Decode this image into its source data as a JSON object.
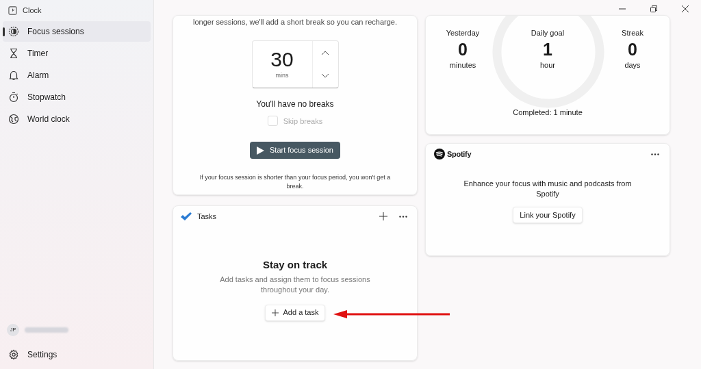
{
  "app_title": "Clock",
  "sidebar": {
    "items": [
      {
        "label": "Focus sessions",
        "selected": true
      },
      {
        "label": "Timer",
        "selected": false
      },
      {
        "label": "Alarm",
        "selected": false
      },
      {
        "label": "Stopwatch",
        "selected": false
      },
      {
        "label": "World clock",
        "selected": false
      }
    ],
    "user": {
      "initials": "JP"
    },
    "settings": "Settings"
  },
  "focus_card": {
    "intro": "longer sessions, we'll add a short break so you can recharge.",
    "minutes": "30",
    "unit": "mins",
    "breaks_note": "You'll have no breaks",
    "skip_breaks": {
      "label": "Skip breaks",
      "checked": false,
      "disabled": true
    },
    "start_button": "Start focus session",
    "footnote": "If your focus session is shorter than your focus period, you won't get a break."
  },
  "tasks_card": {
    "title": "Tasks",
    "heading": "Stay on track",
    "text": "Add tasks and assign them to focus sessions throughout your day.",
    "add_button": "Add a task"
  },
  "progress_card": {
    "stats": [
      {
        "label": "Yesterday",
        "value": "0",
        "unit": "minutes"
      },
      {
        "label": "Daily goal",
        "value": "1",
        "unit": "hour"
      },
      {
        "label": "Streak",
        "value": "0",
        "unit": "days"
      }
    ],
    "completed": "Completed: 1 minute"
  },
  "spotify_card": {
    "title": "Spotify",
    "text": "Enhance your focus with music and podcasts from Spotify",
    "link_button": "Link your Spotify"
  }
}
